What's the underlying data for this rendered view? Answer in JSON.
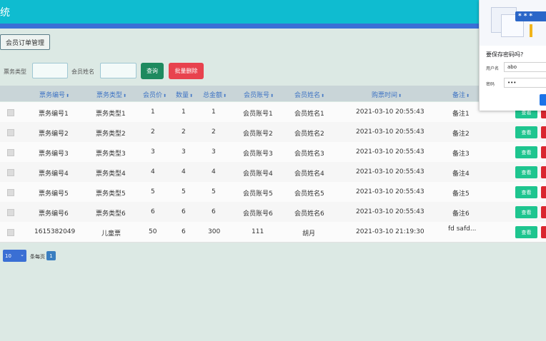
{
  "app": {
    "title": "统"
  },
  "tab": {
    "label": "会员订单管理"
  },
  "search": {
    "ticket_type_label": "票务类型",
    "ticket_type_value": "",
    "member_name_label": "会员姓名",
    "member_name_value": "",
    "query_label": "查询",
    "batch_delete_label": "批量删除"
  },
  "table": {
    "sort_icon": "⬍",
    "headers": [
      "票务编号",
      "票务类型",
      "会员价",
      "数量",
      "总金额",
      "会员账号",
      "会员姓名",
      "购票时间",
      "备注"
    ],
    "view_label": "查看",
    "rows": [
      {
        "no": "票务编号1",
        "type": "票务类型1",
        "price": "1",
        "qty": "1",
        "total": "1",
        "account": "会员账号1",
        "name": "会员姓名1",
        "time": "2021-03-10 20:55:43",
        "note": "备注1"
      },
      {
        "no": "票务编号2",
        "type": "票务类型2",
        "price": "2",
        "qty": "2",
        "total": "2",
        "account": "会员账号2",
        "name": "会员姓名2",
        "time": "2021-03-10 20:55:43",
        "note": "备注2"
      },
      {
        "no": "票务编号3",
        "type": "票务类型3",
        "price": "3",
        "qty": "3",
        "total": "3",
        "account": "会员账号3",
        "name": "会员姓名3",
        "time": "2021-03-10 20:55:43",
        "note": "备注3"
      },
      {
        "no": "票务编号4",
        "type": "票务类型4",
        "price": "4",
        "qty": "4",
        "total": "4",
        "account": "会员账号4",
        "name": "会员姓名4",
        "time": "2021-03-10 20:55:43",
        "note": "备注4"
      },
      {
        "no": "票务编号5",
        "type": "票务类型5",
        "price": "5",
        "qty": "5",
        "total": "5",
        "account": "会员账号5",
        "name": "会员姓名5",
        "time": "2021-03-10 20:55:43",
        "note": "备注5"
      },
      {
        "no": "票务编号6",
        "type": "票务类型6",
        "price": "6",
        "qty": "6",
        "total": "6",
        "account": "会员账号6",
        "name": "会员姓名6",
        "time": "2021-03-10 20:55:43",
        "note": "备注6"
      },
      {
        "no": "1615382049",
        "type": "儿童票",
        "price": "50",
        "qty": "6",
        "total": "300",
        "account": "111",
        "name": "胡月",
        "time": "2021-03-10 21:19:30",
        "note": "fd safd..."
      }
    ]
  },
  "pager": {
    "page_size": "10",
    "per_page_label": "条每页",
    "current_page": "1"
  },
  "password_popup": {
    "illustration_text": "***",
    "title": "要保存密码吗?",
    "username_label": "用户名",
    "username_value": "abo",
    "password_label": "密码",
    "password_value": "•••"
  },
  "colors": {
    "topbar": "#0fbcd0",
    "accent_strip": "#3b6fd6",
    "query_button": "#1e8a5f",
    "delete_button": "#e8424e",
    "view_button": "#1ec58f"
  }
}
